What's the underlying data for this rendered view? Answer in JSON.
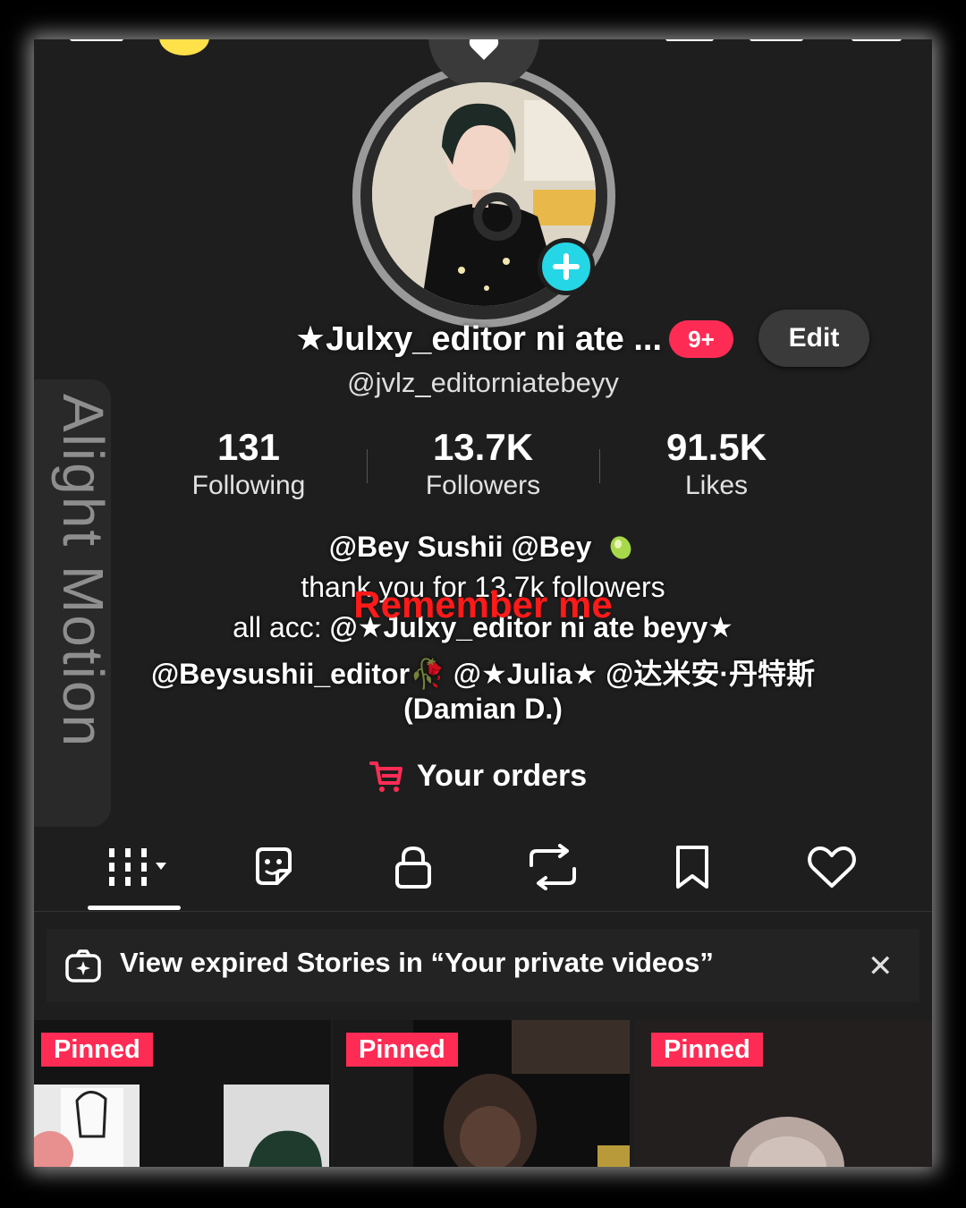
{
  "profile": {
    "display_name": "★Julxy_editor ni ate ...",
    "notification_badge": "9+",
    "edit_label": "Edit",
    "handle": "@jvlz_editorniatebeyy"
  },
  "stats": [
    {
      "value": "131",
      "label": "Following"
    },
    {
      "value": "13.7K",
      "label": "Followers"
    },
    {
      "value": "91.5K",
      "label": "Likes"
    }
  ],
  "bio": {
    "line1": "@Bey Sushii @Bey",
    "line2": "thank you for 13.7k followers",
    "line3_prefix": "all acc: ",
    "line3_bold": "@★Julxy_editor ni ate beyy★",
    "line4": "@Beysushii_editor🥀 @★Julia★ @达米安·丹特斯",
    "line5": "(Damian D.)"
  },
  "overlay_text": "Remember me",
  "watermark": "Alight Motion",
  "orders": {
    "label": "Your orders",
    "icon": "cart-icon"
  },
  "tabs": [
    {
      "name": "videos",
      "icon": "grid-bars-icon",
      "active": true
    },
    {
      "name": "stickers",
      "icon": "sticker-icon"
    },
    {
      "name": "private",
      "icon": "lock-icon"
    },
    {
      "name": "reposts",
      "icon": "repost-icon"
    },
    {
      "name": "saved",
      "icon": "bookmark-icon"
    },
    {
      "name": "liked",
      "icon": "heart-icon"
    }
  ],
  "banner": {
    "text": "View expired Stories in “Your private videos”",
    "close": "✕"
  },
  "videos": [
    {
      "badge": "Pinned"
    },
    {
      "badge": "Pinned"
    },
    {
      "badge": "Pinned"
    }
  ],
  "colors": {
    "background": "#1e1e1e",
    "accent_pink": "#fe2c55",
    "accent_cyan": "#25d6e6",
    "overlay_red": "#ff1a1a"
  }
}
